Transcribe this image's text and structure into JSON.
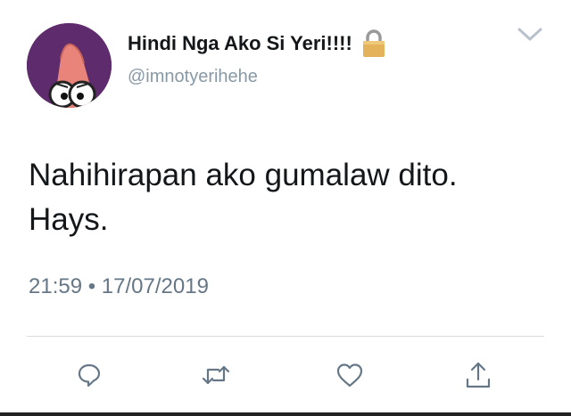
{
  "user": {
    "display_name": "Hindi Nga Ako Si Yeri!!!!",
    "handle": "@imnotyerihehe",
    "avatar_icon": "patrick-star-avatar",
    "protected_icon": "lock-icon"
  },
  "tweet": {
    "text": "Nahihirapan ako gumalaw dito.\nHays.",
    "timestamp": "21:59 • 17/07/2019"
  },
  "actions": [
    {
      "name": "reply",
      "icon": "comment-icon"
    },
    {
      "name": "retweet",
      "icon": "retweet-icon"
    },
    {
      "name": "like",
      "icon": "heart-icon"
    },
    {
      "name": "share",
      "icon": "share-icon"
    }
  ],
  "colors": {
    "text": "#14171a",
    "secondary": "#657786",
    "handle": "#8899a6",
    "icon": "#657786",
    "divider": "#dcdcdc"
  }
}
